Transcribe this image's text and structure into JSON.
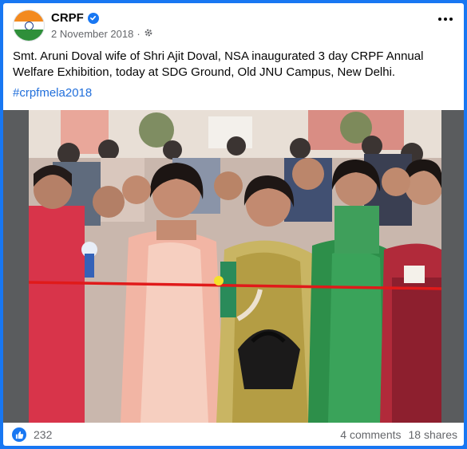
{
  "post": {
    "author": "CRPF",
    "date": "2 November 2018",
    "separator": "·",
    "text": "Smt. Aruni Doval wife of Shri Ajit Doval, NSA inaugurated 3 day CRPF Annual Welfare Exhibition, today at SDG Ground, Old JNU Campus, New Delhi.",
    "hashtag": "#crpfmela2018"
  },
  "icons": {
    "avatar": "indian-flag-avatar",
    "verified": "verified-badge-icon",
    "audience": "globe-gear-icon",
    "more": "more-options-icon",
    "like": "like-thumb-icon"
  },
  "footer": {
    "likes": "232",
    "comments": "4 comments",
    "shares": "18 shares"
  },
  "colors": {
    "frame": "#1877f2",
    "link": "#216fdb",
    "muted": "#65676b"
  }
}
